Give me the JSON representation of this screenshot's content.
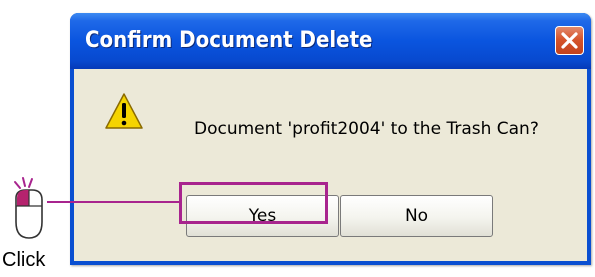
{
  "dialog": {
    "title": "Confirm Document Delete",
    "message": "Document 'profit2004' to the Trash Can?",
    "buttons": {
      "yes": "Yes",
      "no": "No"
    }
  },
  "annotation": {
    "label": "Click"
  },
  "colors": {
    "titlebar": "#0a55df",
    "client_bg": "#ece9d8",
    "close_button": "#d6552c",
    "highlight": "#a8248e",
    "warning": "#f5d400"
  },
  "icons": {
    "warning": "warning-icon",
    "close": "close-icon",
    "mouse": "mouse-icon"
  }
}
